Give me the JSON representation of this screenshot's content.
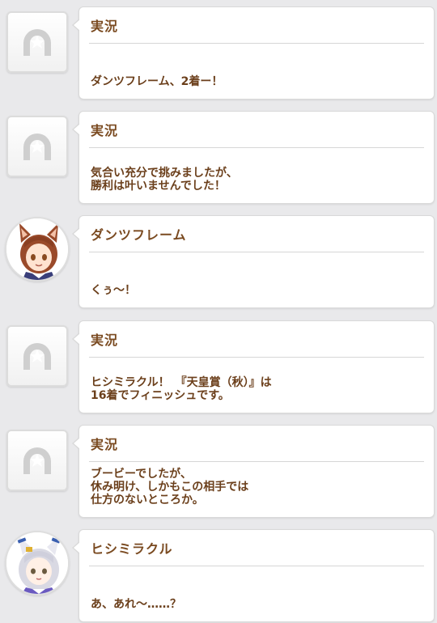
{
  "colors": {
    "background": "#e9e9eb",
    "speaker": "#7a4a20",
    "message": "#6b3f1b"
  },
  "entries": [
    {
      "speaker": "実況",
      "message": "ダンツフレーム、2着ー！",
      "avatar": "horseshoe-icon"
    },
    {
      "speaker": "実況",
      "message": "気合い充分で挑みましたが、\n勝利は叶いませんでした！",
      "avatar": "horseshoe-icon"
    },
    {
      "speaker": "ダンツフレーム",
      "message": "くぅ～！",
      "avatar": "character-portrait"
    },
    {
      "speaker": "実況",
      "message": "ヒシミラクル！　『天皇賞（秋）』は\n16着でフィニッシュです。",
      "avatar": "horseshoe-icon"
    },
    {
      "speaker": "実況",
      "message": "ブービーでしたが、\n休み明け、しかもこの相手では\n仕方のないところか。",
      "avatar": "horseshoe-icon"
    },
    {
      "speaker": "ヒシミラクル",
      "message": "あ、あれ～……？",
      "avatar": "character-portrait"
    }
  ]
}
